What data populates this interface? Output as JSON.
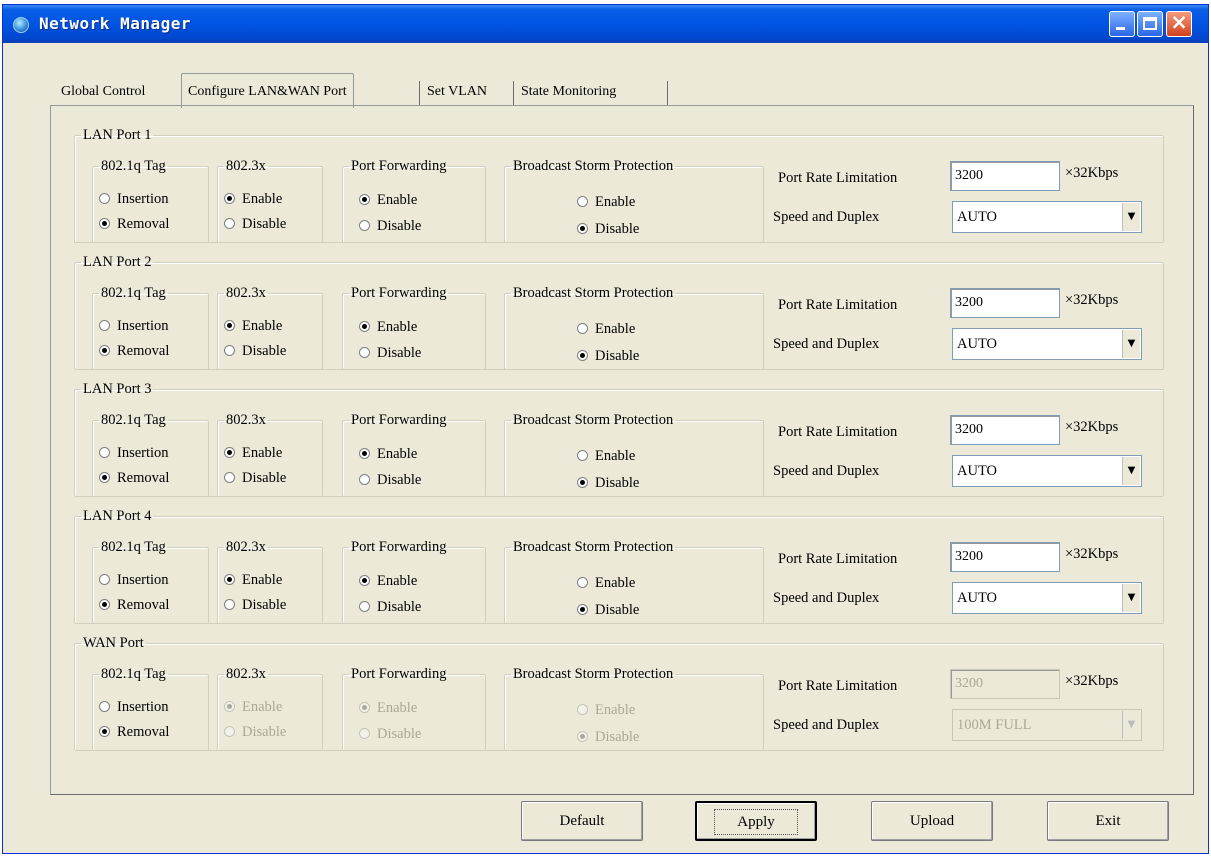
{
  "window": {
    "title": "Network Manager"
  },
  "tabs": [
    "Global Control",
    "Configure LAN&WAN Port",
    "Set VLAN",
    "State Monitoring"
  ],
  "labels": {
    "tag_group": "802.1q Tag",
    "x_group": "802.3x",
    "fwd_group": "Port Forwarding",
    "storm_group": "Broadcast Storm Protection",
    "insertion": "Insertion",
    "removal": "Removal",
    "enable": "Enable",
    "disable": "Disable",
    "rate_label": "Port Rate Limitation",
    "rate_unit": "×32Kbps",
    "speed_label": "Speed and Duplex"
  },
  "ports": [
    {
      "name": "LAN Port 1",
      "tag": "Removal",
      "x8023": "Enable",
      "forwarding": "Enable",
      "storm": "Disable",
      "rate": "3200",
      "speed": "AUTO",
      "disabled": false
    },
    {
      "name": "LAN Port 2",
      "tag": "Removal",
      "x8023": "Enable",
      "forwarding": "Enable",
      "storm": "Disable",
      "rate": "3200",
      "speed": "AUTO",
      "disabled": false
    },
    {
      "name": "LAN Port 3",
      "tag": "Removal",
      "x8023": "Enable",
      "forwarding": "Enable",
      "storm": "Disable",
      "rate": "3200",
      "speed": "AUTO",
      "disabled": false
    },
    {
      "name": "LAN Port 4",
      "tag": "Removal",
      "x8023": "Enable",
      "forwarding": "Enable",
      "storm": "Disable",
      "rate": "3200",
      "speed": "AUTO",
      "disabled": false
    },
    {
      "name": "WAN Port",
      "tag": "Removal",
      "x8023": "Enable",
      "forwarding": "Enable",
      "storm": "Disable",
      "rate": "3200",
      "speed": "100M FULL",
      "disabled": true
    }
  ],
  "buttons": {
    "default": "Default",
    "apply": "Apply",
    "upload": "Upload",
    "exit": "Exit"
  }
}
